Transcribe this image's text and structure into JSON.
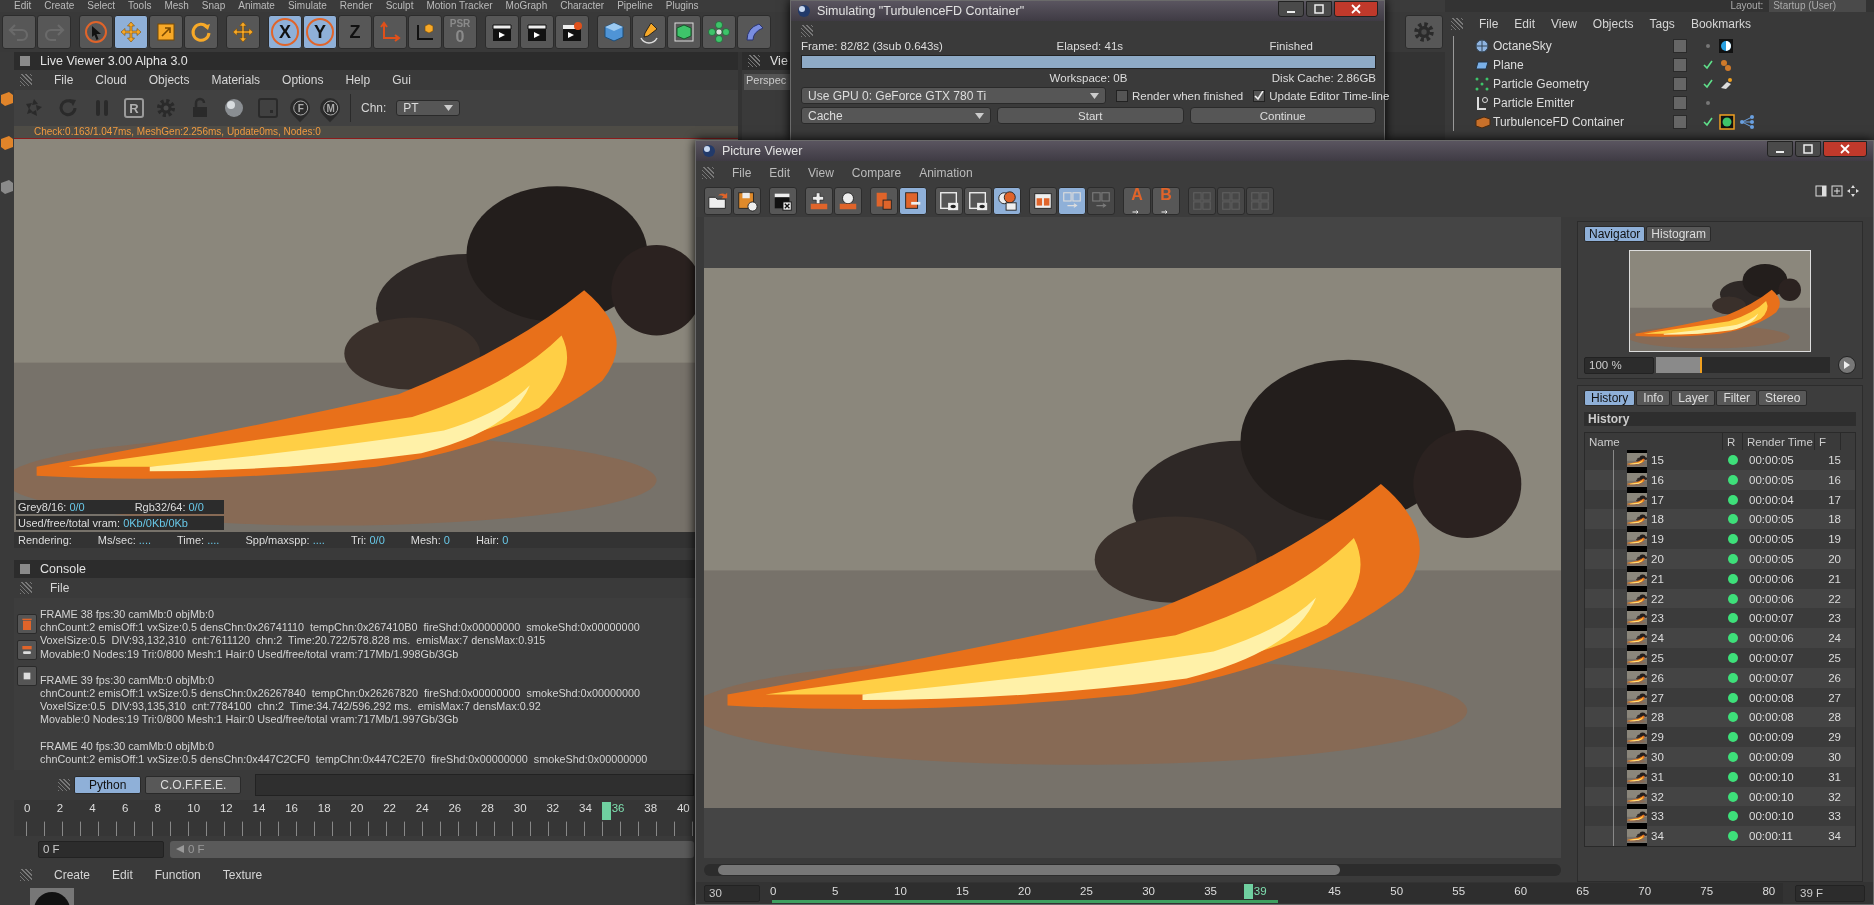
{
  "app_menu": [
    "Edit",
    "Create",
    "Select",
    "Tools",
    "Mesh",
    "Snap",
    "Animate",
    "Simulate",
    "Render",
    "Sculpt",
    "Motion Tracker",
    "MoGraph",
    "Character",
    "Pipeline",
    "Plugins"
  ],
  "main_toolbar": [
    [
      {
        "kind": "undo",
        "selected": false
      },
      {
        "kind": "redo",
        "selected": false
      }
    ],
    [
      {
        "kind": "pointer",
        "selected": false
      },
      {
        "kind": "move",
        "selected": true
      },
      {
        "kind": "scale",
        "selected": false
      },
      {
        "kind": "rotate",
        "selected": false
      }
    ],
    [
      {
        "kind": "move",
        "selected": false
      }
    ],
    [
      {
        "kind": "letter",
        "label": "X",
        "selected": true
      },
      {
        "kind": "letter",
        "label": "Y",
        "selected": true
      },
      {
        "kind": "letter",
        "label": "Z",
        "selected": false
      },
      {
        "kind": "axis",
        "selected": false
      },
      {
        "kind": "world",
        "selected": false
      },
      {
        "kind": "psr",
        "label": "PSR",
        "value": "0",
        "selected": false
      }
    ],
    [
      {
        "kind": "clapper",
        "selected": false
      },
      {
        "kind": "clapper",
        "selected": false
      },
      {
        "kind": "clapper-gear",
        "selected": false
      }
    ],
    [
      {
        "kind": "cube",
        "selected": false
      },
      {
        "kind": "pen",
        "selected": false
      },
      {
        "kind": "subdivision",
        "selected": false
      },
      {
        "kind": "array",
        "selected": false
      },
      {
        "kind": "bend",
        "selected": false
      }
    ]
  ],
  "live_viewer": {
    "title": "Live Viewer 3.00 Alpha 3.0",
    "menu": [
      "File",
      "Cloud",
      "Objects",
      "Materials",
      "Options",
      "Help",
      "Gui"
    ],
    "toolbar": [
      {
        "kind": "shutter"
      },
      {
        "kind": "reload"
      },
      {
        "kind": "pause"
      },
      {
        "kind": "letter",
        "label": "R"
      },
      {
        "kind": "gear"
      },
      {
        "kind": "lock"
      },
      {
        "kind": "sphere"
      },
      {
        "kind": "frame"
      },
      {
        "kind": "pin",
        "label": "F"
      },
      {
        "kind": "pin",
        "label": "M"
      }
    ],
    "channel": {
      "label": "Chn:",
      "value": "PT"
    },
    "status": "Check:0.163/1.047ms, MeshGen:2.256ms, Update0ms, Nodes:0",
    "overlay": [
      {
        "label": "Grey8/16:",
        "value": "0/0"
      },
      {
        "label": "Rgb32/64:",
        "value": "0/0"
      }
    ],
    "vram": {
      "label": "Used/free/total vram:",
      "value": "0Kb/0Kb/0Kb"
    },
    "stats": [
      {
        "label": "Rendering:"
      },
      {
        "label": "Ms/sec:",
        "value": "...."
      },
      {
        "label": "Time:",
        "value": "...."
      },
      {
        "label": "Spp/maxspp:",
        "value": "...."
      },
      {
        "label": "Tri:",
        "value": "0/0"
      },
      {
        "label": "Mesh:",
        "value": "0"
      },
      {
        "label": "Hair:",
        "value": "0"
      }
    ]
  },
  "console": {
    "title": "Console",
    "menu": [
      "File"
    ],
    "entries": [
      [
        "FRAME 38 fps:30 camMb:0 objMb:0",
        "chnCount:2 emisOff:1 vxSize:0.5 densChn:0x26741110  tempChn:0x267410B0  fireShd:0x00000000  smokeShd:0x00000000",
        "VoxelSize:0.5  DIV:93,132,310  cnt:7611120  chn:2  Time:20.722/578.828 ms.  emisMax:7 densMax:0.915",
        "Movable:0 Nodes:19 Tri:0/800 Mesh:1 Hair:0 Used/free/total vram:717Mb/1.998Gb/3Gb"
      ],
      [
        "FRAME 39 fps:30 camMb:0 objMb:0",
        "chnCount:2 emisOff:1 vxSize:0.5 densChn:0x26267840  tempChn:0x26267820  fireShd:0x00000000  smokeShd:0x00000000",
        "VoxelSize:0.5  DIV:93,135,310  cnt:7784100  chn:2  Time:34.742/596.292 ms.  emisMax:7 densMax:0.92",
        "Movable:0 Nodes:19 Tri:0/800 Mesh:1 Hair:0 Used/free/total vram:717Mb/1.997Gb/3Gb"
      ],
      [
        "FRAME 40 fps:30 camMb:0 objMb:0",
        "chnCount:2 emisOff:1 vxSize:0.5 densChn:0x447C2CF0  tempChn:0x447C2E70  fireShd:0x00000000  smokeShd:0x00000000"
      ]
    ],
    "tabs": [
      {
        "label": "Python",
        "selected": true
      },
      {
        "label": "C.O.F.F.E.E.",
        "selected": false
      }
    ]
  },
  "timeline": {
    "ticks": [
      {
        "label": "0",
        "selected": false
      },
      {
        "label": "2",
        "selected": false
      },
      {
        "label": "4",
        "selected": false
      },
      {
        "label": "6",
        "selected": false
      },
      {
        "label": "8",
        "selected": false
      },
      {
        "label": "10",
        "selected": false
      },
      {
        "label": "12",
        "selected": false
      },
      {
        "label": "14",
        "selected": false
      },
      {
        "label": "16",
        "selected": false
      },
      {
        "label": "18",
        "selected": false
      },
      {
        "label": "20",
        "selected": false
      },
      {
        "label": "22",
        "selected": false
      },
      {
        "label": "24",
        "selected": false
      },
      {
        "label": "26",
        "selected": false
      },
      {
        "label": "28",
        "selected": false
      },
      {
        "label": "30",
        "selected": false
      },
      {
        "label": "32",
        "selected": false
      },
      {
        "label": "34",
        "selected": false
      },
      {
        "label": "36",
        "selected": true
      },
      {
        "label": "38",
        "selected": false
      },
      {
        "label": "40",
        "selected": false
      }
    ],
    "frame_field": "0 F",
    "scrub": "0 F"
  },
  "material_manager": {
    "menu": [
      "Create",
      "Edit",
      "Function",
      "Texture"
    ]
  },
  "view_panel": {
    "title": "Vie",
    "camera": "Perspec"
  },
  "object_manager": {
    "layout": {
      "label": "Layout:",
      "value": "Startup (User)"
    },
    "menu": [
      "File",
      "Edit",
      "View",
      "Objects",
      "Tags",
      "Bookmarks"
    ],
    "objects": [
      {
        "name": "OctaneSky",
        "kind": "sky",
        "checked": false
      },
      {
        "name": "Plane",
        "kind": "plane",
        "checked": true
      },
      {
        "name": "Particle Geometry",
        "kind": "particles",
        "checked": true
      },
      {
        "name": "Particle Emitter",
        "kind": "emitter",
        "checked": false
      },
      {
        "name": "TurbulenceFD Container",
        "kind": "container",
        "checked": true
      }
    ]
  },
  "simulation": {
    "title": "Simulating \"TurbulenceFD Container\"",
    "frame": "Frame: 82/82 (3sub 0.643s)",
    "elapsed": "Elapsed: 41s",
    "state": "Finished",
    "level": 1,
    "workspace": "Workspace: 0B",
    "disk_cache": "Disk Cache: 2.86GB",
    "gpu": "Use GPU 0: GeForce GTX 780 Ti",
    "options": [
      {
        "label": "Render when finished",
        "checked": false
      },
      {
        "label": "Update Editor Time-line",
        "checked": true
      }
    ],
    "mode": "Cache",
    "buttons": [
      "Start",
      "Continue"
    ]
  },
  "picture_viewer": {
    "title": "Picture Viewer",
    "menu": [
      "File",
      "Edit",
      "View",
      "Compare",
      "Animation"
    ],
    "toolbar": [
      [
        {
          "kind": "folder",
          "selected": false,
          "disabled": false
        },
        {
          "kind": "disk",
          "selected": false,
          "disabled": false
        }
      ],
      [
        {
          "kind": "clapper-x",
          "selected": false,
          "disabled": false
        }
      ],
      [
        {
          "kind": "grid-export",
          "selected": false,
          "disabled": false
        },
        {
          "kind": "sphere-export",
          "selected": false,
          "disabled": false
        }
      ],
      [
        {
          "kind": "doc-trash",
          "selected": false,
          "disabled": false
        },
        {
          "kind": "doc-list",
          "selected": true,
          "disabled": false
        }
      ],
      [
        {
          "kind": "frame-eye",
          "selected": false,
          "disabled": false
        },
        {
          "kind": "frame-eye",
          "selected": false,
          "disabled": false
        },
        {
          "kind": "circles-eye",
          "selected": true,
          "disabled": false
        }
      ],
      [
        {
          "kind": "split",
          "selected": false,
          "disabled": false
        },
        {
          "kind": "swap",
          "selected": true,
          "disabled": false
        },
        {
          "kind": "swap",
          "selected": false,
          "disabled": true
        }
      ],
      [
        {
          "kind": "arrow-letter",
          "label": "A",
          "selected": false,
          "disabled": false
        },
        {
          "kind": "arrow-letter",
          "label": "B",
          "selected": false,
          "disabled": false
        }
      ],
      [
        {
          "kind": "compare",
          "selected": false,
          "disabled": true
        },
        {
          "kind": "compare",
          "selected": false,
          "disabled": true
        },
        {
          "kind": "compare",
          "selected": false,
          "disabled": true
        }
      ]
    ],
    "navigator": {
      "tabs": [
        {
          "label": "Navigator",
          "selected": true
        },
        {
          "label": "Histogram",
          "selected": false
        }
      ],
      "zoom": "100 %",
      "level": 0.25
    },
    "panel_tabs": [
      {
        "label": "History",
        "selected": true
      },
      {
        "label": "Info",
        "selected": false
      },
      {
        "label": "Layer",
        "selected": false
      },
      {
        "label": "Filter",
        "selected": false
      },
      {
        "label": "Stereo",
        "selected": false
      }
    ],
    "history": {
      "title": "History",
      "columns": [
        "Name",
        "R",
        "Render Time",
        "F"
      ],
      "rows": [
        {
          "name": "15",
          "rendered": true,
          "render_time": "00:00:05",
          "frame": "15"
        },
        {
          "name": "16",
          "rendered": true,
          "render_time": "00:00:05",
          "frame": "16"
        },
        {
          "name": "17",
          "rendered": true,
          "render_time": "00:00:04",
          "frame": "17"
        },
        {
          "name": "18",
          "rendered": true,
          "render_time": "00:00:05",
          "frame": "18"
        },
        {
          "name": "19",
          "rendered": true,
          "render_time": "00:00:05",
          "frame": "19"
        },
        {
          "name": "20",
          "rendered": true,
          "render_time": "00:00:05",
          "frame": "20"
        },
        {
          "name": "21",
          "rendered": true,
          "render_time": "00:00:06",
          "frame": "21"
        },
        {
          "name": "22",
          "rendered": true,
          "render_time": "00:00:06",
          "frame": "22"
        },
        {
          "name": "23",
          "rendered": true,
          "render_time": "00:00:07",
          "frame": "23"
        },
        {
          "name": "24",
          "rendered": true,
          "render_time": "00:00:06",
          "frame": "24"
        },
        {
          "name": "25",
          "rendered": true,
          "render_time": "00:00:07",
          "frame": "25"
        },
        {
          "name": "26",
          "rendered": true,
          "render_time": "00:00:07",
          "frame": "26"
        },
        {
          "name": "27",
          "rendered": true,
          "render_time": "00:00:08",
          "frame": "27"
        },
        {
          "name": "28",
          "rendered": true,
          "render_time": "00:00:08",
          "frame": "28"
        },
        {
          "name": "29",
          "rendered": true,
          "render_time": "00:00:09",
          "frame": "29"
        },
        {
          "name": "30",
          "rendered": true,
          "render_time": "00:00:09",
          "frame": "30"
        },
        {
          "name": "31",
          "rendered": true,
          "render_time": "00:00:10",
          "frame": "31"
        },
        {
          "name": "32",
          "rendered": true,
          "render_time": "00:00:10",
          "frame": "32"
        },
        {
          "name": "33",
          "rendered": true,
          "render_time": "00:00:10",
          "frame": "33"
        },
        {
          "name": "34",
          "rendered": true,
          "render_time": "00:00:11",
          "frame": "34"
        }
      ]
    },
    "frame_rate": "30",
    "ruler": {
      "ticks": [
        {
          "label": "0",
          "selected": false
        },
        {
          "label": "5",
          "selected": false
        },
        {
          "label": "10",
          "selected": false
        },
        {
          "label": "15",
          "selected": false
        },
        {
          "label": "20",
          "selected": false
        },
        {
          "label": "25",
          "selected": false
        },
        {
          "label": "30",
          "selected": false
        },
        {
          "label": "35",
          "selected": false
        },
        {
          "label": "39",
          "selected": true
        },
        {
          "label": "45",
          "selected": false
        },
        {
          "label": "50",
          "selected": false
        },
        {
          "label": "55",
          "selected": false
        },
        {
          "label": "60",
          "selected": false
        },
        {
          "label": "65",
          "selected": false
        },
        {
          "label": "70",
          "selected": false
        },
        {
          "label": "75",
          "selected": false
        },
        {
          "label": "80",
          "selected": false
        }
      ],
      "level": 0.5
    },
    "frame_field": "39 F"
  }
}
